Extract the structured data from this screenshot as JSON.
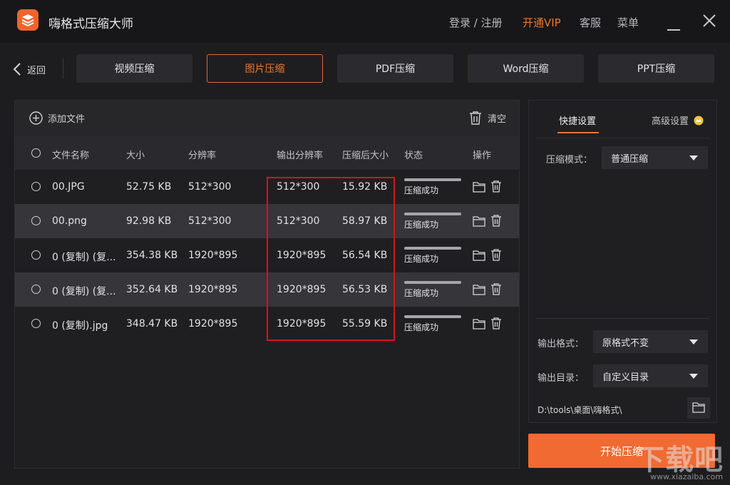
{
  "app": {
    "title": "嗨格式压缩大师"
  },
  "titlebar": {
    "login": "登录 / 注册",
    "vip": "开通VIP",
    "service": "客服",
    "menu": "菜单"
  },
  "nav": {
    "back": "返回",
    "tabs": [
      "视频压缩",
      "图片压缩",
      "PDF压缩",
      "Word压缩",
      "PPT压缩"
    ],
    "active_tab": "图片压缩"
  },
  "toolbar": {
    "add_file": "添加文件",
    "clear": "清空"
  },
  "table": {
    "headers": [
      "文件名称",
      "大小",
      "分辨率",
      "输出分辨率",
      "压缩后大小",
      "状态",
      "操作"
    ],
    "rows": [
      {
        "name": "00.JPG",
        "size": "52.75 KB",
        "resolution": "512*300",
        "output_resolution": "512*300",
        "compressed_size": "15.92 KB",
        "status": "压缩成功",
        "progress": 1.0
      },
      {
        "name": "00.png",
        "size": "92.98 KB",
        "resolution": "512*300",
        "output_resolution": "512*300",
        "compressed_size": "58.97 KB",
        "status": "压缩成功",
        "progress": 1.0
      },
      {
        "name": "0 (复制) (复...",
        "size": "354.38 KB",
        "resolution": "1920*895",
        "output_resolution": "1920*895",
        "compressed_size": "56.54 KB",
        "status": "压缩成功",
        "progress": 1.0
      },
      {
        "name": "0 (复制) (复...",
        "size": "352.64 KB",
        "resolution": "1920*895",
        "output_resolution": "1920*895",
        "compressed_size": "56.53 KB",
        "status": "压缩成功",
        "progress": 1.0
      },
      {
        "name": "0 (复制).jpg",
        "size": "348.47 KB",
        "resolution": "1920*895",
        "output_resolution": "1920*895",
        "compressed_size": "55.59 KB",
        "status": "压缩成功",
        "progress": 1.0
      }
    ]
  },
  "settings": {
    "tabs": [
      "快捷设置",
      "高级设置"
    ],
    "mode_label": "压缩模式：",
    "mode_value": "普通压缩",
    "format_label": "输出格式：",
    "format_value": "原格式不变",
    "dir_label": "输出目录：",
    "dir_value": "自定义目录",
    "path": "D:\\tools\\桌面\\嗨格式\\"
  },
  "start_button": "开始压缩",
  "watermark": {
    "main": "下载吧",
    "sub": "www.xiazaiba.com"
  },
  "colors": {
    "accent": "#f0762c",
    "highlight": "#d4141a",
    "background": "#1d1d20"
  }
}
